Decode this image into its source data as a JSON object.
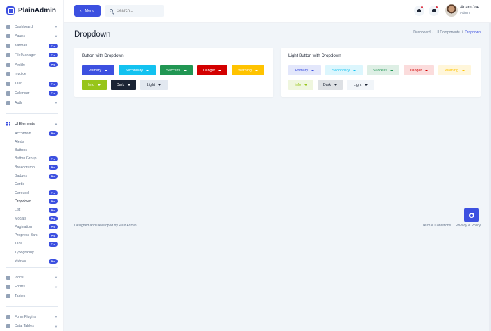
{
  "app": {
    "name": "PlainAdmin"
  },
  "sidebar": {
    "main_items": [
      {
        "label": "Dashboard",
        "chevron": true
      },
      {
        "label": "Pages",
        "chevron": true
      },
      {
        "label": "Kanban",
        "badge": "Pro"
      },
      {
        "label": "File Manager",
        "badge": "Pro"
      },
      {
        "label": "Profile",
        "badge": "Pro"
      },
      {
        "label": "Invoice"
      },
      {
        "label": "Task",
        "badge": "Pro"
      },
      {
        "label": "Calendar",
        "badge": "Pro"
      },
      {
        "label": "Auth",
        "chevron": true
      }
    ],
    "ui_section": {
      "label": "UI Elements"
    },
    "ui_items": [
      {
        "label": "Accordion",
        "badge": "Pro"
      },
      {
        "label": "Alerts"
      },
      {
        "label": "Buttons"
      },
      {
        "label": "Button Group",
        "badge": "Pro"
      },
      {
        "label": "Breadcrumb",
        "badge": "Pro"
      },
      {
        "label": "Badges",
        "badge": "Pro"
      },
      {
        "label": "Cards"
      },
      {
        "label": "Carousel",
        "badge": "Pro"
      },
      {
        "label": "Dropdown",
        "badge": "Pro",
        "active": true
      },
      {
        "label": "List",
        "badge": "Pro"
      },
      {
        "label": "Modals",
        "badge": "Pro"
      },
      {
        "label": "Pagination",
        "badge": "Pro"
      },
      {
        "label": "Progress Bars",
        "badge": "Pro"
      },
      {
        "label": "Tabs",
        "badge": "Pro"
      },
      {
        "label": "Typography"
      },
      {
        "label": "Videos",
        "badge": "Pro"
      }
    ],
    "bottom_items": [
      {
        "label": "Icons",
        "chevron": true
      },
      {
        "label": "Forms",
        "chevron": true
      },
      {
        "label": "Tables"
      }
    ],
    "plugin_items": [
      {
        "label": "Form Plugins",
        "chevron": true
      },
      {
        "label": "Data Tables",
        "chevron": true
      }
    ]
  },
  "header": {
    "menu_label": "Menu",
    "search_placeholder": "Search...",
    "user": {
      "name": "Adam Joe",
      "role": "Admin"
    }
  },
  "page": {
    "title": "Dropdown",
    "breadcrumb": [
      "Dashboard",
      "/",
      "UI Components",
      "/",
      "Dropdown"
    ]
  },
  "cards": [
    {
      "title": "Button with Dropdown",
      "buttons": [
        {
          "label": "Primary",
          "bg": "#3c50e0",
          "fg": "#ffffff"
        },
        {
          "label": "Secondary",
          "bg": "#13c2f0",
          "fg": "#ffffff"
        },
        {
          "label": "Success",
          "bg": "#219653",
          "fg": "#ffffff"
        },
        {
          "label": "Danger",
          "bg": "#d30000",
          "fg": "#ffffff"
        },
        {
          "label": "Warning",
          "bg": "#ffc300",
          "fg": "#ffffff"
        },
        {
          "label": "Info",
          "bg": "#97c51a",
          "fg": "#ffffff"
        },
        {
          "label": "Dark",
          "bg": "#1c2434",
          "fg": "#ffffff"
        },
        {
          "label": "Light",
          "bg": "#e2e8f0",
          "fg": "#1c2434"
        }
      ]
    },
    {
      "title": "Light Button with Dropdown",
      "buttons": [
        {
          "label": "Primary",
          "bg": "#e3e7fb",
          "fg": "#3c50e0"
        },
        {
          "label": "Secondary",
          "bg": "#dcf6fd",
          "fg": "#13c2f0"
        },
        {
          "label": "Success",
          "bg": "#deefe5",
          "fg": "#219653"
        },
        {
          "label": "Danger",
          "bg": "#fbdcdc",
          "fg": "#d30000"
        },
        {
          "label": "Warning",
          "bg": "#fff6da",
          "fg": "#ffc300"
        },
        {
          "label": "Info",
          "bg": "#eff6de",
          "fg": "#97c51a"
        },
        {
          "label": "Dark",
          "bg": "#dde0e4",
          "fg": "#1c2434"
        },
        {
          "label": "Light",
          "bg": "#f1f5f9",
          "fg": "#1c2434"
        }
      ]
    }
  ],
  "footer": {
    "credit": "Designed and Developed by PlainAdmin",
    "links": [
      "Term & Conditions",
      "Privacy & Policy"
    ]
  }
}
